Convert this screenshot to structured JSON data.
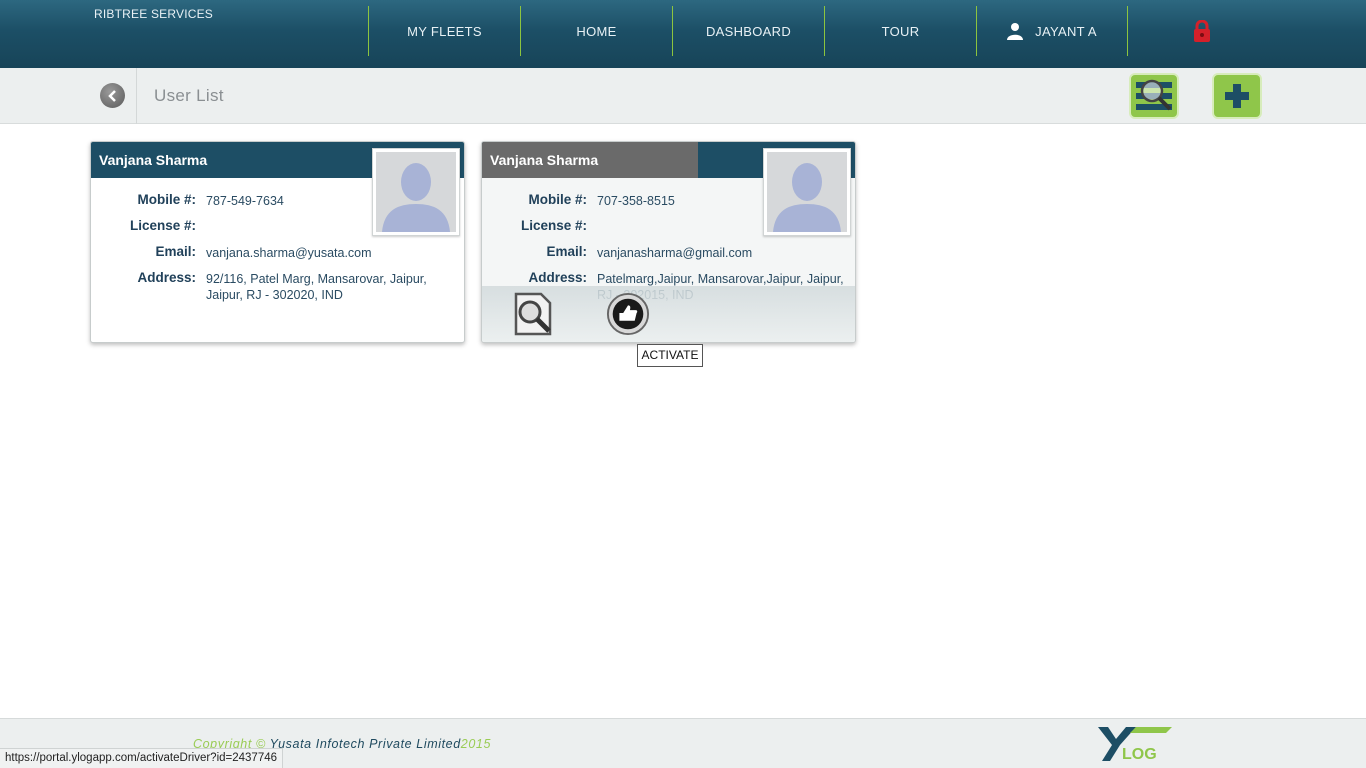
{
  "header": {
    "brand": "RIBTREE SERVICES",
    "nav": [
      {
        "label": "MY FLEETS"
      },
      {
        "label": "HOME"
      },
      {
        "label": "DASHBOARD"
      },
      {
        "label": "TOUR"
      },
      {
        "label": "JAYANT A"
      }
    ]
  },
  "subbar": {
    "title": "User List"
  },
  "labels": {
    "mobile": "Mobile #:",
    "license": "License #:",
    "email": "Email:",
    "address": "Address:"
  },
  "cards": [
    {
      "name": "Vanjana Sharma",
      "mobile": "787-549-7634",
      "license": "",
      "email": "vanjana.sharma@yusata.com",
      "address": "92/116, Patel Marg, Mansarovar, Jaipur, Jaipur, RJ - 302020, IND"
    },
    {
      "name": "Vanjana Sharma",
      "mobile": "707-358-8515",
      "license": "",
      "email": "vanjanasharma@gmail.com",
      "address": "Patelmarg,Jaipur, Mansarovar,Jaipur, Jaipur, RJ - 302015, IND"
    }
  ],
  "tooltip": "ACTIVATE",
  "footer": {
    "copyright_prefix": "Copyright © ",
    "company": "Yusata Infotech Private Limited",
    "year": "2015",
    "logo_text": "LOG"
  },
  "status_url": "https://portal.ylogapp.com/activateDriver?id=2437746",
  "colors": {
    "header": "#1c4f66",
    "accent": "#8fc64a",
    "lock": "#d4202a"
  }
}
